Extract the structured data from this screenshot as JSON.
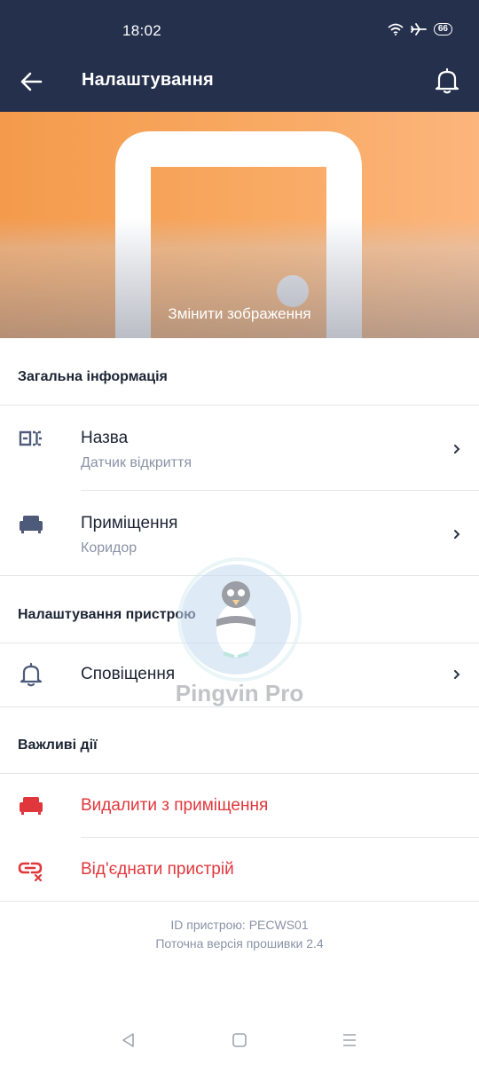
{
  "status_bar": {
    "time": "18:02",
    "battery": "66",
    "icons": [
      "wifi-icon",
      "airplane-icon",
      "battery-icon"
    ]
  },
  "app_bar": {
    "title": "Налаштування",
    "back_icon": "arrow-left-icon",
    "bell_icon": "bell-icon"
  },
  "hero": {
    "caption": "Змінити зображення",
    "colors": {
      "start": "#f49a4c",
      "end": "#fcb57c"
    }
  },
  "sections": {
    "general": {
      "header": "Загальна інформація",
      "name": {
        "title": "Назва",
        "value": "Датчик відкриття",
        "icon": "label-icon"
      },
      "room": {
        "title": "Приміщення",
        "value": "Коридор",
        "icon": "sofa-icon"
      }
    },
    "device": {
      "header": "Налаштування пристрою",
      "notifications": {
        "title": "Сповіщення",
        "icon": "bell-icon"
      }
    },
    "actions": {
      "header": "Важливі дії",
      "remove_from_room": {
        "title": "Видалити з приміщення",
        "icon": "sofa-icon"
      },
      "disconnect": {
        "title": "Від'єднати пристрій",
        "icon": "unlink-icon"
      }
    }
  },
  "footer": {
    "device_id": "ID пристрою: PECWS01",
    "firmware": "Поточна версія прошивки 2.4"
  },
  "watermark": {
    "text": "Pingvin Pro"
  },
  "colors": {
    "header_bg": "#25304c",
    "danger": "#e0373c",
    "text": "#1c2434",
    "muted": "#8a93a6",
    "icon": "#4e5a7a"
  }
}
